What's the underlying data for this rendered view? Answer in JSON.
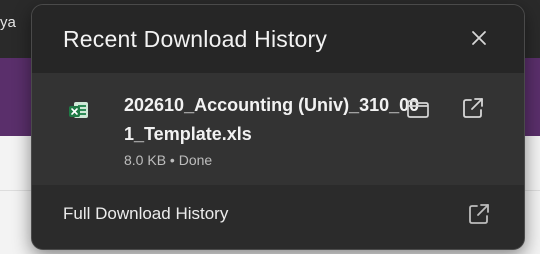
{
  "background": {
    "topbar_text": "ya"
  },
  "popup": {
    "title": "Recent Download History",
    "close_icon": "close-icon",
    "items": [
      {
        "file_name": "202610_Accounting (Univ)_310_001_Template.xls",
        "meta": "8.0 KB • Done",
        "file_icon": "excel-file-icon",
        "actions": [
          "folder-icon",
          "open-external-icon"
        ]
      }
    ],
    "footer": {
      "label": "Full Download History",
      "icon": "open-external-icon"
    }
  },
  "colors": {
    "panel_bg": "#2b2b2b",
    "item_bg": "#333333",
    "excel_green": "#1f7a45",
    "background_purple": "#5a2f6b"
  }
}
